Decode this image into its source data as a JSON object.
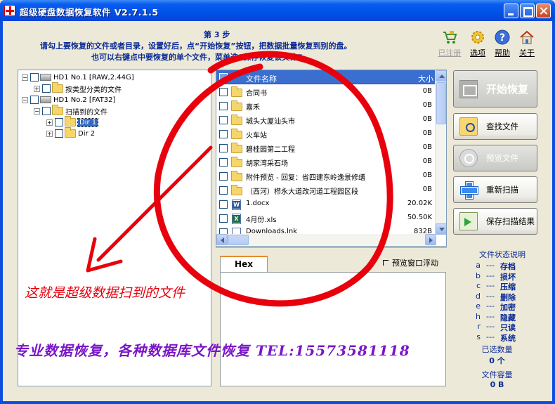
{
  "window": {
    "title": "超级硬盘数据恢复软件  V2.7.1.5"
  },
  "instructions": {
    "step": "第 3 步",
    "line1": "请勾上要恢复的文件或者目录，设置好后，点“开始恢复”按钮，把数据批量恢复到别的盘。",
    "line2": "也可以右键点中要恢复的单个文件，菜单选“保存恢复该文件”。"
  },
  "toolbar": [
    {
      "label": "已注册",
      "icon": "cart-icon",
      "enabled": false
    },
    {
      "label": "选项",
      "icon": "gear-icon",
      "enabled": true
    },
    {
      "label": "帮助",
      "icon": "help-icon",
      "enabled": true
    },
    {
      "label": "关于",
      "icon": "house-icon",
      "enabled": true
    }
  ],
  "tree": [
    {
      "label": "HD1 No.1 [RAW,2.44G]",
      "type": "drive",
      "expander": "−"
    },
    {
      "label": "按类型分类的文件",
      "type": "folder",
      "expander": "+"
    },
    {
      "label": "HD1 No.2 [FAT32]",
      "type": "drive",
      "expander": "−"
    },
    {
      "label": "扫描到的文件",
      "type": "folder",
      "expander": "−"
    },
    {
      "label": "Dir 1",
      "type": "folder",
      "expander": "+",
      "selected": true
    },
    {
      "label": "Dir 2",
      "type": "folder",
      "expander": "+"
    }
  ],
  "file_list": {
    "headers": {
      "name": "文件名称",
      "size": "大小"
    },
    "rows": [
      {
        "name": "合同书",
        "size": "0B",
        "type": "folder"
      },
      {
        "name": "嘉禾",
        "size": "0B",
        "type": "folder"
      },
      {
        "name": "城头大厦汕头市",
        "size": "0B",
        "type": "folder"
      },
      {
        "name": "火车站",
        "size": "0B",
        "type": "folder"
      },
      {
        "name": "碧桂园第二工程",
        "size": "0B",
        "type": "folder"
      },
      {
        "name": "胡家湾采石场",
        "size": "0B",
        "type": "folder"
      },
      {
        "name": "附件预览 - 回复：省四建东岭逸景修缮",
        "size": "0B",
        "type": "folder"
      },
      {
        "name": "（西河）栉永大道改河道工程园区段",
        "size": "0B",
        "type": "folder"
      },
      {
        "name": "1.docx",
        "size": "20.02K",
        "type": "word"
      },
      {
        "name": "4月份.xls",
        "size": "50.50K",
        "type": "xls"
      },
      {
        "name": "Downloads.lnk",
        "size": "832B",
        "type": "doc"
      }
    ]
  },
  "preview": {
    "tab": "Hex",
    "float_label": "预览窗口浮动"
  },
  "actions": {
    "start": "开始恢复",
    "find": "查找文件",
    "preview": "预览文件",
    "rescan": "重新扫描",
    "save_scan": "保存扫描结果"
  },
  "legend": {
    "title": "文件状态说明",
    "items": [
      {
        "key": "a",
        "value": "存档"
      },
      {
        "key": "b",
        "value": "损坏"
      },
      {
        "key": "c",
        "value": "压缩"
      },
      {
        "key": "d",
        "value": "删除"
      },
      {
        "key": "e",
        "value": "加密"
      },
      {
        "key": "h",
        "value": "隐藏"
      },
      {
        "key": "r",
        "value": "只读"
      },
      {
        "key": "s",
        "value": "系统"
      }
    ],
    "dash": "---"
  },
  "stats": {
    "selected_label": "已选数量",
    "selected_value": "0 个",
    "capacity_label": "文件容量",
    "capacity_value": "0 B"
  },
  "annotations": {
    "scan_note": "这就是超级数据扫到的文件",
    "ad": "专业数据恢复，各种数据库文件恢复 TEL:15573581118"
  },
  "colors": {
    "accent": "#316ac5",
    "annotation_red": "#e8000c",
    "annotation_purple": "#7a16c8",
    "instruction_blue": "#0a2a96"
  }
}
